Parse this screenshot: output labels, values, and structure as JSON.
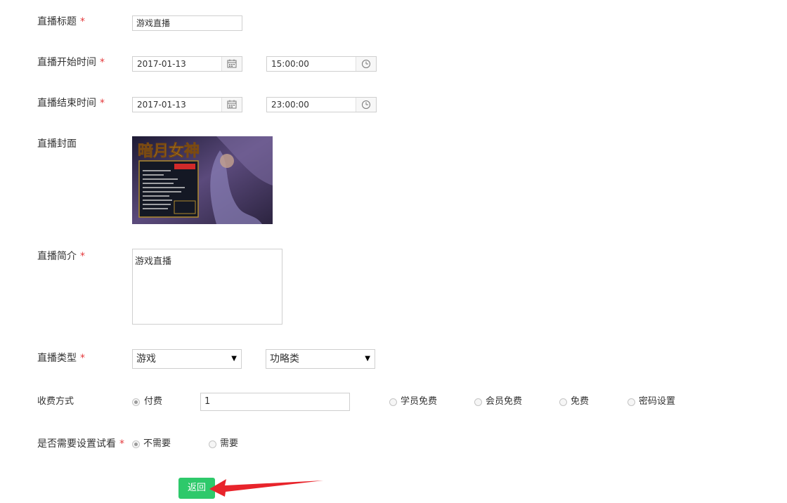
{
  "form": {
    "title_label": "直播标题",
    "title_value": "游戏直播",
    "start_label": "直播开始时间",
    "start_date": "2017-01-13",
    "start_time": "15:00:00",
    "end_label": "直播结束时间",
    "end_date": "2017-01-13",
    "end_time": "23:00:00",
    "cover_label": "直播封面",
    "cover_image_text": "暗月女神",
    "intro_label": "直播简介",
    "intro_value": "游戏直播",
    "type_label": "直播类型",
    "type_value": "游戏",
    "subtype_value": "功略类",
    "fee_label": "收费方式",
    "fee_options": [
      "付费",
      "学员免费",
      "会员免费",
      "免费",
      "密码设置"
    ],
    "fee_selected": "付费",
    "price_value": "1",
    "trial_label": "是否需要设置试看",
    "trial_options": [
      "不需要",
      "需要"
    ],
    "trial_selected": "不需要",
    "required_mark": "*",
    "back_button": "返回"
  },
  "colors": {
    "required": "#e4393c",
    "button_bg": "#2ec96b",
    "annotation_arrow": "#e8242b"
  },
  "icons": {
    "calendar": "calendar-icon",
    "clock": "clock-icon",
    "dropdown": "dropdown-arrow-icon",
    "annotation": "red-arrow-annotation"
  }
}
